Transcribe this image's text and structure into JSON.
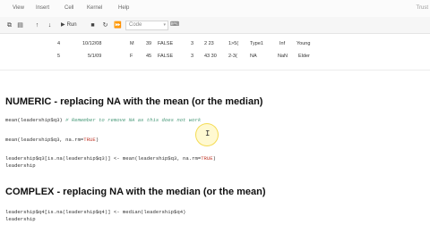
{
  "menu": {
    "items": [
      "View",
      "Insert",
      "Cell",
      "Kernel",
      "Help"
    ],
    "trusted": "Trust"
  },
  "toolbar": {
    "run_label": "Run",
    "cell_type": "Code"
  },
  "table": {
    "rows": [
      [
        "4",
        "10/12/08",
        "M",
        "39",
        "FALSE",
        "3",
        "2 23",
        "1>5(",
        "Type1",
        "Inf",
        "Young"
      ],
      [
        "5",
        "5/1/09",
        "F",
        "45",
        "FALSE",
        "3",
        "43 30",
        "2-3(",
        "NA",
        "NaN",
        "Elder"
      ]
    ]
  },
  "sections": {
    "numeric_heading": "NUMERIC - replacing NA with the mean (or the median)",
    "complex_heading": "COMPLEX - replacing NA with the median (or the mean)"
  },
  "code": {
    "c1_code": "mean(leadership$q3)",
    "c1_comment": " # Remember to remove NA as this does not work",
    "c2_a": "mean(leadership$q3, na.rm=",
    "c2_b": "TRUE",
    "c2_c": ")",
    "c3_a": "leadership$q3[is.na(leadership$q3)] <- mean(leadership$q3, na.rm=",
    "c3_b": "TRUE",
    "c3_c": ")",
    "c3_line2": "leadership",
    "c4_line1": "leadership$q4[is.na(leadership$q4)] <- median(leadership$q4)",
    "c4_line2": "leadership"
  }
}
